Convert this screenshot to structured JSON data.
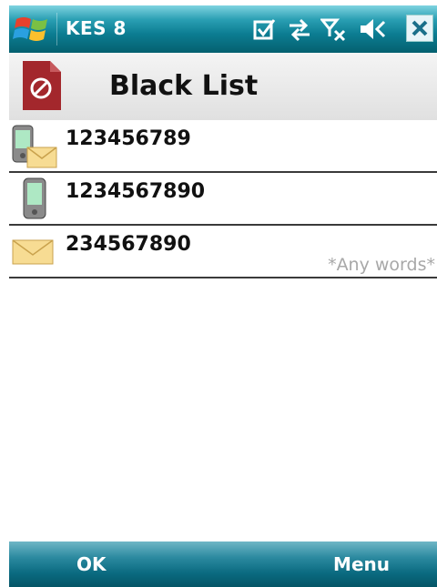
{
  "status_bar": {
    "app_name": "KES 8",
    "icons": [
      "windows-start-icon",
      "tasks-icon",
      "data-connection-icon",
      "no-signal-icon",
      "volume-mute-icon",
      "close-icon"
    ]
  },
  "header": {
    "title": "Black List",
    "icon": "blocked-icon",
    "accent": "#a3272c"
  },
  "entries": [
    {
      "number": "123456789",
      "filter": "",
      "icon": "phone-and-sms-icon"
    },
    {
      "number": "1234567890",
      "filter": "",
      "icon": "phone-icon"
    },
    {
      "number": "234567890",
      "filter": "*Any words*",
      "icon": "sms-icon"
    }
  ],
  "softkeys": {
    "left": "OK",
    "right": "Menu"
  }
}
